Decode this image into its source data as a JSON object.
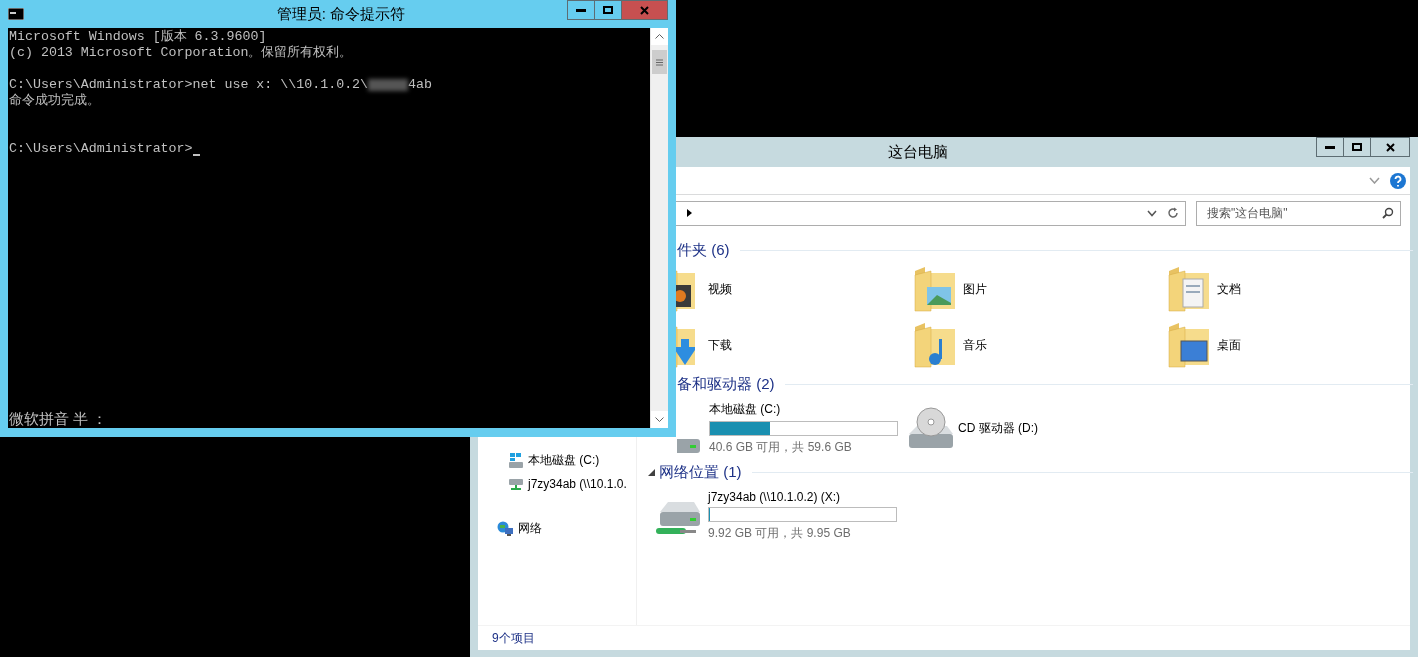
{
  "cmd_window": {
    "title": "管理员: 命令提示符",
    "lines": [
      {
        "kind": "text",
        "text": "Microsoft Windows [版本 6.3.9600]"
      },
      {
        "kind": "text",
        "text": "(c) 2013 Microsoft Corporation。保留所有权利。"
      },
      {
        "kind": "blank"
      },
      {
        "kind": "masked",
        "before": "C:\\Users\\Administrator>net use x: \\\\10.1.0.2\\",
        "after": "4ab"
      },
      {
        "kind": "text",
        "text": "命令成功完成。"
      },
      {
        "kind": "blank"
      },
      {
        "kind": "blank"
      },
      {
        "kind": "prompt",
        "text": "C:\\Users\\Administrator>"
      }
    ],
    "ime_status": "微软拼音 半 ："
  },
  "explorer_window": {
    "title": "这台电脑",
    "search": {
      "placeholder": "搜索\"这台电脑\""
    },
    "sidebar": {
      "this_pc_items": [
        {
          "kind": "drive",
          "label": "本地磁盘 (C:)"
        },
        {
          "kind": "netdrive",
          "label": "j7zy34ab (\\\\10.1.0."
        }
      ],
      "network": {
        "label": "网络"
      }
    },
    "groups": [
      {
        "label": "件夹 (6)",
        "items": [
          {
            "kind": "folder",
            "name": "视频"
          },
          {
            "kind": "folder",
            "name": "图片"
          },
          {
            "kind": "folder",
            "name": "文档"
          },
          {
            "kind": "folder",
            "name": "下载"
          },
          {
            "kind": "folder",
            "name": "音乐"
          },
          {
            "kind": "folder",
            "name": "桌面"
          }
        ]
      },
      {
        "label": "备和驱动器 (2)",
        "items": [
          {
            "kind": "drive",
            "name": "本地磁盘 (C:)",
            "level": 0.32,
            "free": "40.6 GB 可用，共 59.6 GB"
          },
          {
            "kind": "cd",
            "name": "CD 驱动器 (D:)"
          }
        ]
      },
      {
        "label": "网络位置 (1)",
        "expanded": true,
        "items": [
          {
            "kind": "netdrive",
            "name": "j7zy34ab (\\\\10.1.0.2) (X:)",
            "level": 0.003,
            "free": "9.92 GB 可用，共 9.95 GB"
          }
        ]
      }
    ],
    "status_bar": "9个项目"
  }
}
